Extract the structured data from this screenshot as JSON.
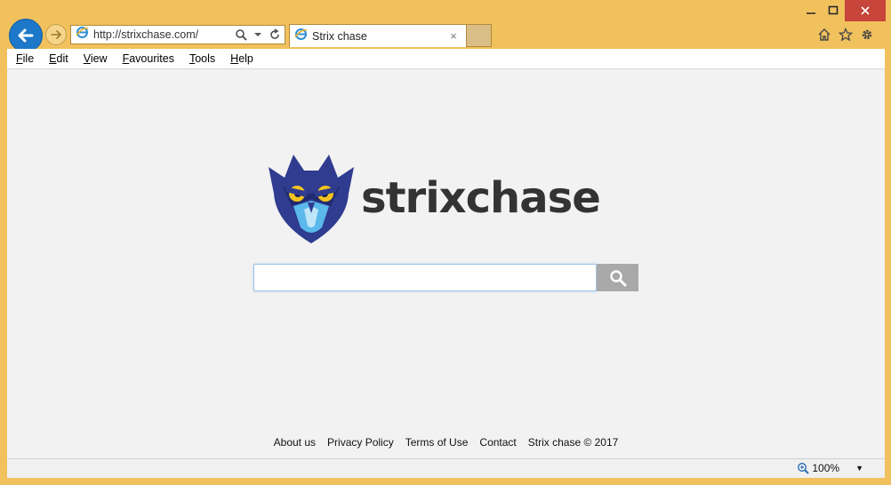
{
  "browser": {
    "address": "http://strixchase.com/",
    "tab_title": "Strix chase",
    "tab_close": "×",
    "menu": [
      {
        "label": "File",
        "key": "F",
        "rest": "ile"
      },
      {
        "label": "Edit",
        "key": "E",
        "rest": "dit"
      },
      {
        "label": "View",
        "key": "V",
        "rest": "iew"
      },
      {
        "label": "Favourites",
        "key": "F",
        "rest": "avourites"
      },
      {
        "label": "Tools",
        "key": "T",
        "rest": "ools"
      },
      {
        "label": "Help",
        "key": "H",
        "rest": "elp"
      }
    ],
    "zoom": "100%",
    "zoom_dropdown": "▼"
  },
  "page": {
    "logo_text": "strixchase",
    "search_placeholder": "",
    "footer": [
      "About us",
      "Privacy Policy",
      "Terms of Use",
      "Contact",
      "Strix chase © 2017"
    ]
  },
  "colors": {
    "frame": "#f1c15e",
    "back_button": "#1d78c9",
    "close_button": "#c7453a",
    "owl_dark": "#2f3c8f",
    "owl_light": "#5bb8ea",
    "owl_eye": "#f3c21e"
  },
  "icons": {
    "back": "arrow-left-icon",
    "forward": "arrow-right-icon",
    "search": "magnifier-icon",
    "refresh": "refresh-icon",
    "home": "home-icon",
    "favorites": "star-icon",
    "tools": "gear-icon"
  }
}
